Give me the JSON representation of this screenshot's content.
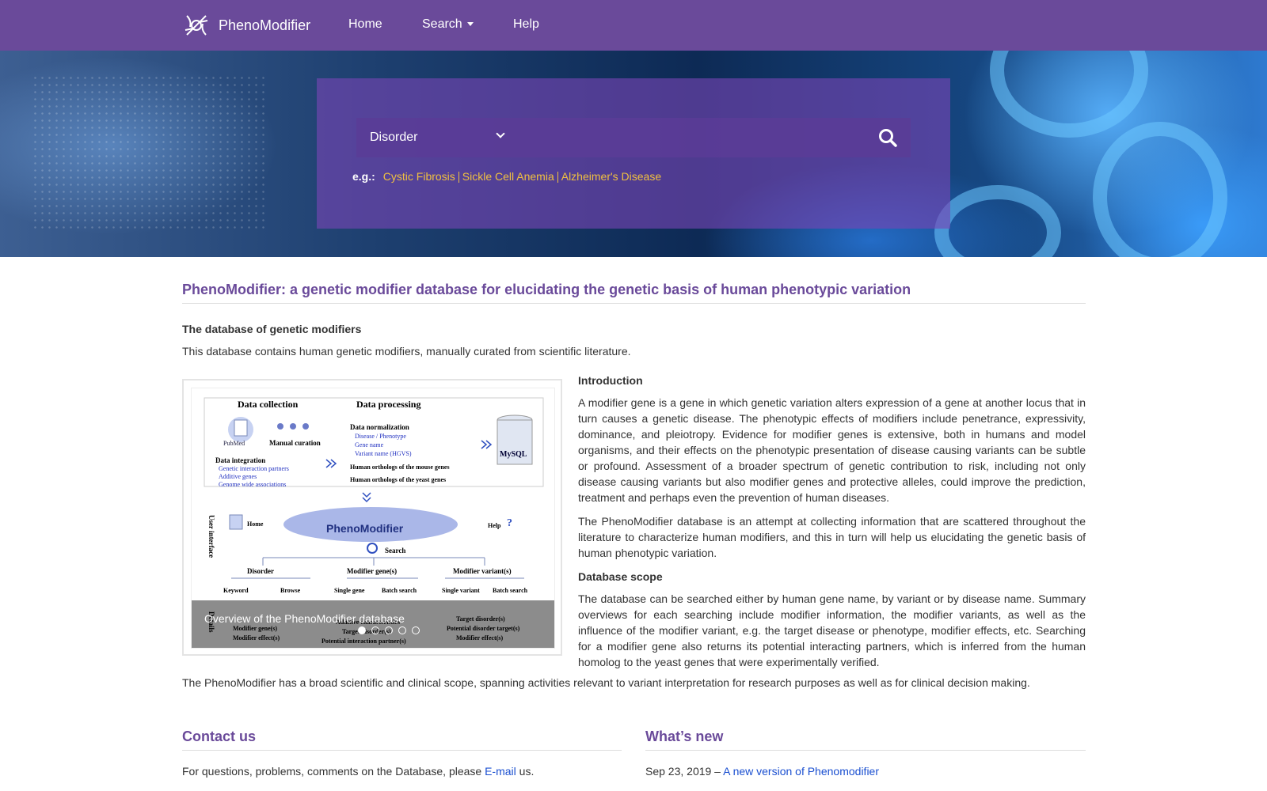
{
  "nav": {
    "brand": "PhenoModifier",
    "items": [
      {
        "label": "Home"
      },
      {
        "label": "Search"
      },
      {
        "label": "Help"
      }
    ]
  },
  "search": {
    "selected_category": "Disorder",
    "examples_label": "e.g.:",
    "examples": [
      "Cystic Fibrosis",
      "Sickle Cell Anemia",
      "Alzheimer's Disease"
    ]
  },
  "main": {
    "title": "PhenoModifier: a genetic modifier database for elucidating the genetic basis of human phenotypic variation",
    "subheading": "The database of genetic modifiers",
    "subtext": "This database contains human genetic modifiers, manually curated from scientific literature.",
    "carousel": {
      "caption": "Overview of the PhenoModifier database",
      "slide_count": 5,
      "active_index": 0,
      "figure": {
        "col_collection": "Data collection",
        "col_processing": "Data processing",
        "pubmed": "PubMed",
        "manual_curation": "Manual curation",
        "data_normalization": "Data normalization",
        "norm_items": [
          "Disease / Phenotype",
          "Gene name",
          "Variant name (HGVS)"
        ],
        "mysql": "MySQL",
        "data_integration": "Data integration",
        "integration_items": [
          "Genetic interaction partners",
          "Additive genes",
          "Genome wide associations"
        ],
        "orthologs_mouse": "Human orthologs of the mouse genes",
        "orthologs_yeast": "Human orthologs of the yeast genes",
        "user_interface": "User interface",
        "home": "Home",
        "hub": "PhenoModifier",
        "help": "Help",
        "search": "Search",
        "disorder": "Disorder",
        "modifier_genes": "Modifier gene(s)",
        "modifier_variants": "Modifier variant(s)",
        "keyword": "Keyword",
        "browse": "Browse",
        "single_gene": "Single gene",
        "batch_search": "Batch search",
        "single_variant": "Single variant",
        "details": "Details",
        "detail_left": [
          "Modifier gene(s)",
          "Modifier effect(s)"
        ],
        "detail_mid": [
          "Additive characteristics",
          "Target disorder(s)",
          "Potential interaction partner(s)"
        ],
        "detail_right": [
          "Target disorder(s)",
          "Potential disorder target(s)",
          "Modifier effect(s)"
        ]
      }
    },
    "intro_heading": "Introduction",
    "intro_p1": "A modifier gene is a gene in which genetic variation alters expression of a gene at another locus that in turn causes a genetic disease. The phenotypic effects of modifiers include penetrance, expressivity, dominance, and pleiotropy. Evidence for modifier genes is extensive, both in humans and model organisms, and their effects on the phenotypic presentation of disease causing variants can be subtle or profound. Assessment of a broader spectrum of genetic contribution to risk, including not only disease causing variants but also modifier genes and protective alleles, could improve the prediction, treatment and perhaps even the prevention of human diseases.",
    "intro_p2": "The PhenoModifier database is an attempt at collecting information that are scattered throughout the literature to characterize human modifiers, and this in turn will help us elucidating the genetic basis of human phenotypic variation.",
    "scope_heading": "Database scope",
    "scope_p": "The database can be searched either by human gene name, by variant or by disease name. Summary overviews for each searching include modifier information, the modifier variants, as well as the influence of the modifier variant, e.g. the target disease or phenotype, modifier effects, etc. Searching for a modifier gene also returns its potential interacting partners, which is inferred from the human homolog to the yeast genes that were experimentally verified.",
    "scope_line": "The PhenoModifier has a broad scientific and clinical scope, spanning activities relevant to variant interpretation for research purposes as well as for clinical decision making."
  },
  "contact": {
    "heading": "Contact us",
    "text_before": "For questions, problems, comments on the Database, please",
    "email_link": "E-mail",
    "text_after": "us."
  },
  "news": {
    "heading": "What’s new",
    "items": [
      {
        "date": "Sep 23, 2019 –",
        "link": "A new version of Phenomodifier"
      }
    ]
  },
  "colors": {
    "brand_purple": "#6a4a9a",
    "example_gold": "#f0c040",
    "link_blue": "#1a4fd0"
  },
  "icons": {
    "logo": "dna-logo-icon",
    "search": "search-icon",
    "caret": "caret-down-icon"
  }
}
